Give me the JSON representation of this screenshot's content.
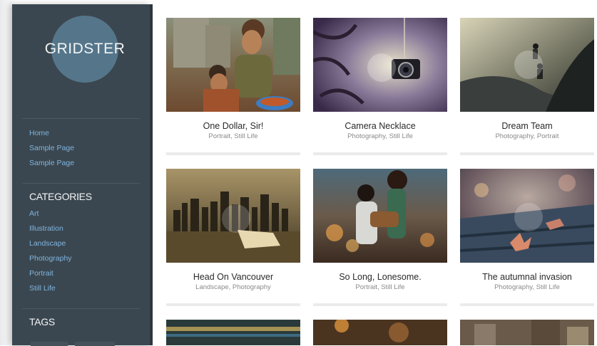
{
  "site": {
    "logo_text": "GRIDSTER"
  },
  "menu": [
    {
      "label": "Home"
    },
    {
      "label": "Sample Page"
    },
    {
      "label": "Sample Page"
    }
  ],
  "categories": {
    "heading": "CATEGORIES",
    "items": [
      {
        "label": "Art"
      },
      {
        "label": "Illustration"
      },
      {
        "label": "Landscape"
      },
      {
        "label": "Photography"
      },
      {
        "label": "Portrait"
      },
      {
        "label": "Still Life"
      }
    ]
  },
  "tags": {
    "heading": "TAGS"
  },
  "posts": [
    {
      "title": "One Dollar, Sir!",
      "categories": "Portrait, Still Life"
    },
    {
      "title": "Camera Necklace",
      "categories": "Photography, Still Life"
    },
    {
      "title": "Dream Team",
      "categories": "Photography, Portrait"
    },
    {
      "title": "Head On Vancouver",
      "categories": "Landscape, Photography"
    },
    {
      "title": "So Long, Lonesome.",
      "categories": "Portrait, Still Life"
    },
    {
      "title": "The autumnal invasion",
      "categories": "Photography, Still Life"
    }
  ],
  "colors": {
    "sidebar_bg": "#3b4750",
    "logo_circle": "#55768a",
    "link": "#7fb5df",
    "heading": "#f2f4f5"
  }
}
